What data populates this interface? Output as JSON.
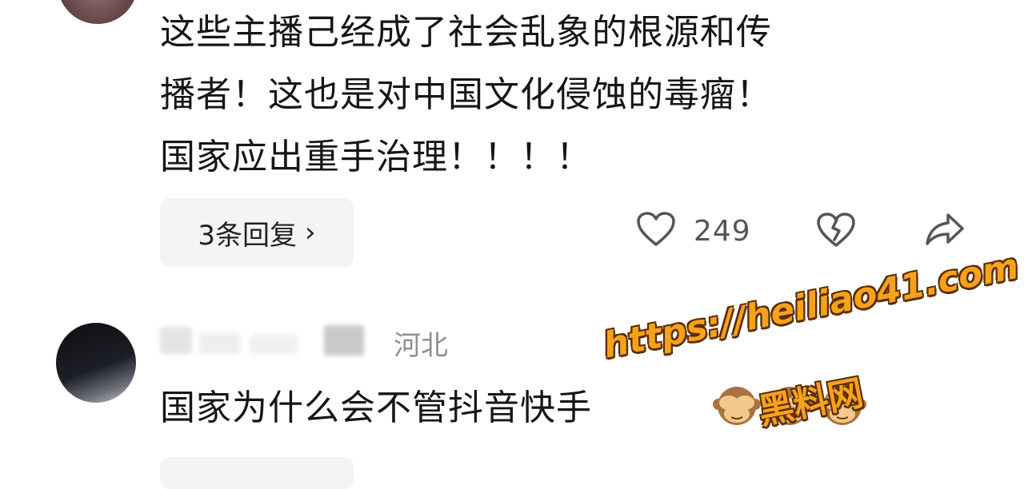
{
  "comment1": {
    "lines": [
      "这些主播己经成了社会乱象的根源和传",
      "播者！这也是对中国文化侵蚀的毒瘤！",
      "国家应出重手治理！！！！"
    ],
    "replies_label": "3条回复",
    "replies_chevron": "›",
    "like_count": "249"
  },
  "comment2": {
    "location": "河北",
    "text": "国家为什么会不管抖音快手",
    "emoji": "🙈"
  },
  "watermark": {
    "url": "https://heiliao41.com",
    "name": "黑料网"
  },
  "colors": {
    "text": "#161616",
    "muted": "#8e8e93",
    "pill_bg": "#f4f4f5",
    "watermark": "#f7a21b"
  }
}
